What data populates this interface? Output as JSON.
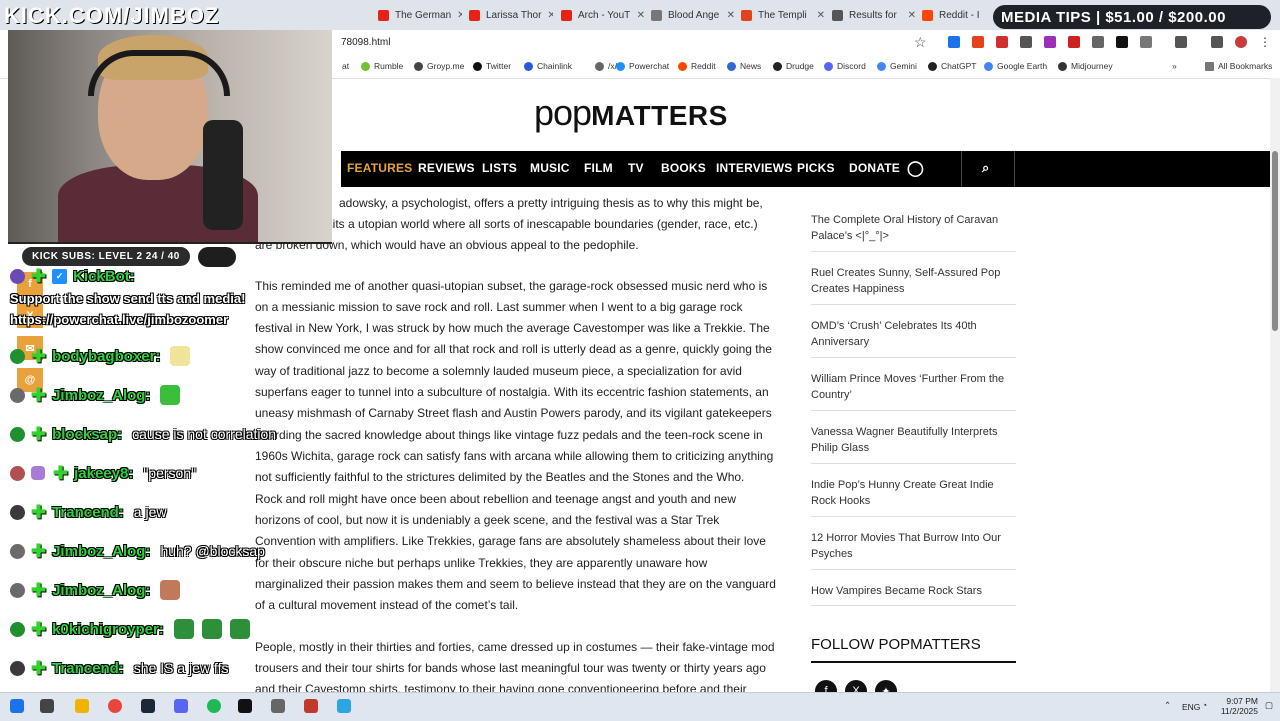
{
  "overlay": {
    "title": "KICK.COM/JIMBOZ",
    "kick_subs": "KICK SUBS: LEVEL 2 24 / 40",
    "media_tips": "MEDIA TIPS | $51.00 / $200.00"
  },
  "browser": {
    "tabs": [
      {
        "title": "The German",
        "color": "#e62117"
      },
      {
        "title": "Larissa Thor",
        "color": "#e62117"
      },
      {
        "title": "Arch - YouT",
        "color": "#e62117"
      },
      {
        "title": "Blood Ange",
        "color": "#777777"
      },
      {
        "title": "The Templi",
        "color": "#e2431a"
      },
      {
        "title": "Results for",
        "color": "#555555"
      },
      {
        "title": "Reddit - I",
        "color": "#ff4500"
      }
    ],
    "url": "78098.html",
    "bookmarks": [
      {
        "label": "at",
        "color": "#ffffff"
      },
      {
        "label": "Rumble",
        "color": "#74c23c"
      },
      {
        "label": "Groyp.me",
        "color": "#444444"
      },
      {
        "label": "Twitter",
        "color": "#111111"
      },
      {
        "label": "Chainlink",
        "color": "#2a5ada"
      },
      {
        "label": "/x/",
        "color": "#666666"
      },
      {
        "label": "Powerchat",
        "color": "#1e90ff"
      },
      {
        "label": "Reddit",
        "color": "#ff4500"
      },
      {
        "label": "News",
        "color": "#3367d6"
      },
      {
        "label": "Drudge",
        "color": "#222222"
      },
      {
        "label": "Discord",
        "color": "#5865f2"
      },
      {
        "label": "Gemini",
        "color": "#4285f4"
      },
      {
        "label": "ChatGPT",
        "color": "#222222"
      },
      {
        "label": "Google Earth",
        "color": "#4285f4"
      },
      {
        "label": "Midjourney",
        "color": "#333333"
      }
    ],
    "all_bookmarks": "All Bookmarks"
  },
  "site": {
    "logo_pop": "pop",
    "logo_matters": "MATTERS",
    "nav": [
      "FEATURES",
      "REVIEWS",
      "LISTS",
      "MUSIC",
      "FILM",
      "TV",
      "BOOKS",
      "INTERVIEWS",
      "PICKS",
      "DONATE"
    ],
    "article_lines": [
      "adowsky, a psychologist, offers a pretty intriguing thesis as to why this might be,",
      "osits a utopian world where all sorts of inescapable boundaries (gender, race, etc.)",
      "are broken down, which would have an obvious appeal to the pedophile.",
      "This reminded me of another quasi-utopian subset, the garage-rock obsessed music nerd who is",
      "on a messianic mission to save rock and roll. Last summer when I went to a big garage rock",
      "festival in New York, I was struck by how much the average Cavestomper was like a Trekkie. The",
      "show convinced me once and for all that rock and roll is utterly dead as a genre, quickly going the",
      "way of traditional jazz to become a solemnly lauded museum piece, a specialization for avid",
      "superfans eager to tunnel into a subculture of nostalgia. With its eccentric fashion statements, an",
      "uneasy mishmash of Carnaby Street flash and Austin Powers parody, and its vigilant gatekeepers",
      "hoarding the sacred knowledge about things like vintage fuzz pedals and the teen-rock scene in",
      "1960s Wichita, garage rock can satisfy fans with arcana while allowing them to criticizing anything",
      "not sufficiently faithful to the strictures delimited by the Beatles and the Stones and the Who.",
      "Rock and roll might have once been about rebellion and teenage angst and youth and new",
      "horizons of cool, but now it is undeniably a geek scene, and the festival was a Star Trek",
      "Convention with amplifiers. Like Trekkies, garage fans are absolutely shameless about their love",
      "for their obscure niche but perhaps unlike Trekkies, they are apparently unaware how",
      "marginalized their passion makes them and seem to believe instead that they are on the vanguard",
      "of a cultural movement instead of the comet’s tail.",
      "People, mostly in their thirties and forties, came dressed up in costumes — their fake-vintage mod",
      "trousers and their tour shirts for bands whose last meaningful tour was twenty or thirty years ago",
      "and their Cavestomp shirts, testimony to their having gone conventioneering before and their"
    ],
    "sidebar_links": [
      "The Complete Oral History of Caravan Palace’s <|°_°|>",
      "Ruel Creates Sunny, Self-Assured Pop Creates Happiness",
      "OMD’s ‘Crush’ Celebrates Its 40th Anniversary",
      "William Prince Moves ‘Further From the Country’",
      "Vanessa Wagner Beautifully Interprets Philip Glass",
      "Indie Pop’s Hunny Create Great Indie Rock Hooks",
      "12 Horror Movies That Burrow Into Our Psyches",
      "How Vampires Became Rock Stars"
    ],
    "follow_heading": "FOLLOW POPMATTERS"
  },
  "chat": {
    "kickbot": {
      "user": "KickBot:",
      "line1": "Support the show send tts and media!",
      "line2": "https://powerchat.live/jimbozoomer"
    },
    "messages": [
      {
        "user": "bodybagboxer:",
        "text": "",
        "badge": "#1f8f2f"
      },
      {
        "user": "Jimboz_Alog:",
        "text": "",
        "badge": "#6a6a6a"
      },
      {
        "user": "blocksap:",
        "text": "cause is not correlation",
        "badge": "#1f8f2f"
      },
      {
        "user": "jakeey8:",
        "text": "\"person\"",
        "badge": "#b05050"
      },
      {
        "user": "Trancend:",
        "text": "a jew",
        "badge": "#3a3a3a"
      },
      {
        "user": "Jimboz_Alog:",
        "text": "huh? @blocksap",
        "badge": "#6a6a6a"
      },
      {
        "user": "Jimboz_Alog:",
        "text": "",
        "badge": "#6a6a6a"
      },
      {
        "user": "k0kichigroyper:",
        "text": "",
        "badge": "#1f8f2f"
      },
      {
        "user": "Trancend:",
        "text": "she IS a jew ffs",
        "badge": "#3a3a3a"
      }
    ]
  },
  "taskbar": {
    "lang": "ENG",
    "time": "9:07 PM",
    "date": "11/2/2025"
  }
}
